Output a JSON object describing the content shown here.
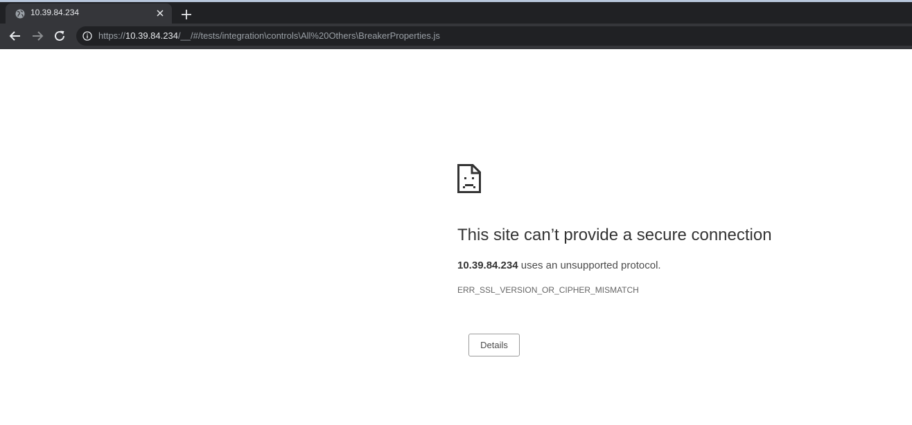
{
  "browser": {
    "tab": {
      "title": "10.39.84.234",
      "favicon": "globe-icon",
      "close_icon": "close-icon"
    },
    "new_tab_icon": "plus-icon",
    "nav": {
      "back_icon": "arrow-left-icon",
      "forward_icon": "arrow-right-icon",
      "reload_icon": "reload-icon"
    },
    "address_bar": {
      "security_icon": "info-icon",
      "scheme": "https://",
      "host": "10.39.84.234",
      "path": "/__/#/tests/integration\\controls\\All%20Others\\BreakerProperties.js"
    },
    "colors": {
      "tabstrip": "#202124",
      "toolbar": "#35363a",
      "omnibox": "#202124",
      "accent": "#b8c7dc"
    }
  },
  "error_page": {
    "icon": "sad-document-icon",
    "heading": "This site can’t provide a secure connection",
    "summary_host": "10.39.84.234",
    "summary_text": " uses an unsupported protocol.",
    "error_code": "ERR_SSL_VERSION_OR_CIPHER_MISMATCH",
    "details_button": "Details"
  }
}
